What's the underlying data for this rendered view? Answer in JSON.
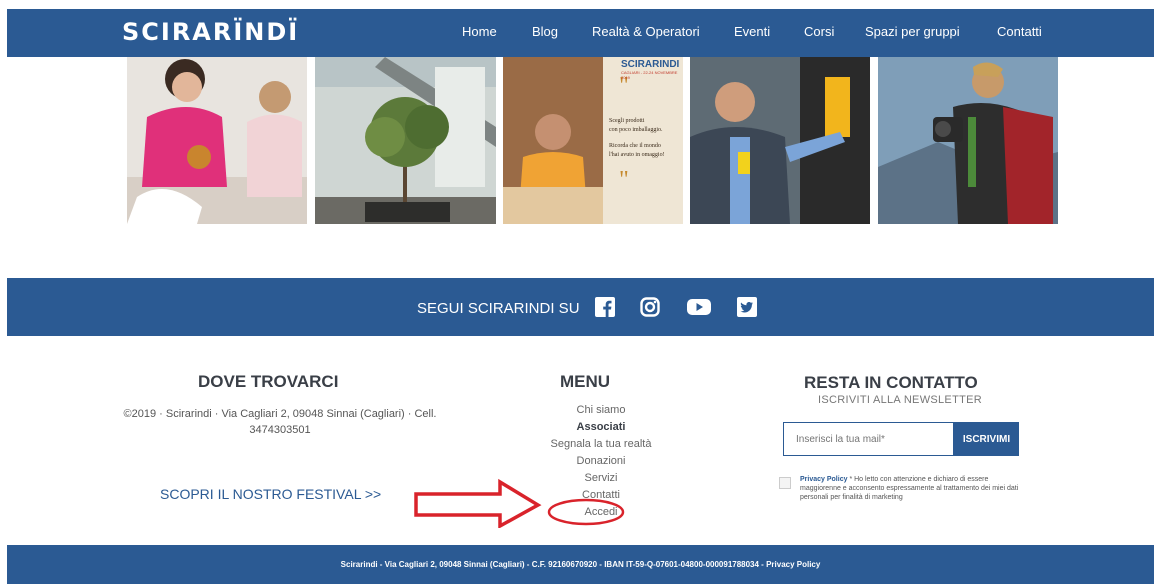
{
  "nav": {
    "logo": "SCIRARÏNDÏ",
    "items": [
      "Home",
      "Blog",
      "Realtà & Operatori",
      "Eventi",
      "Corsi",
      "Spazi per gruppi",
      "Contatti"
    ]
  },
  "photos": {
    "festival_card": {
      "brand": "SCIRARINDI",
      "dates": "CAGLIARI - 22-24 NOVEMBRE 2019",
      "line1": "Scegli prodotti",
      "line2": "con poco imballaggio.",
      "line3": "Ricorda che il mondo",
      "line4": "l'hai avuto in omaggio!"
    }
  },
  "social": {
    "label": "SEGUI SCIRARINDI SU",
    "icons": [
      "facebook-icon",
      "instagram-icon",
      "youtube-icon",
      "twitter-icon"
    ]
  },
  "dove": {
    "title": "DOVE TROVARCI",
    "address": "©2019 · Scirarindi · Via Cagliari 2, 09048 Sinnai (Cagliari) · Cell. 3474303501",
    "festival_link": "SCOPRI IL NOSTRO FESTIVAL >>"
  },
  "menu": {
    "title": "MENU",
    "items": [
      "Chi siamo",
      "Associati",
      "Segnala la tua realtà",
      "Donazioni",
      "Servizi",
      "Contatti",
      "Accedi"
    ]
  },
  "contatto": {
    "title": "RESTA IN CONTATTO",
    "subtitle": "ISCRIVITI ALLA NEWSLETTER",
    "email_placeholder": "Inserisci la tua mail*",
    "button": "ISCRIVIMI",
    "privacy_label": "Privacy Policy",
    "privacy_text": "* Ho letto con attenzione e dichiaro di essere maggiorenne e acconsento espressamente al trattamento dei miei dati personali per finalità di marketing"
  },
  "footer": {
    "text": "Scirarindi - Via Cagliari 2, 09048 Sinnai (Cagliari) - C.F. 92160670920 - IBAN IT-59-Q-07601-04800-000091788034 - Privacy Policy"
  },
  "colors": {
    "brand_blue": "#2b5a93",
    "annotation_red": "#d9232b"
  }
}
